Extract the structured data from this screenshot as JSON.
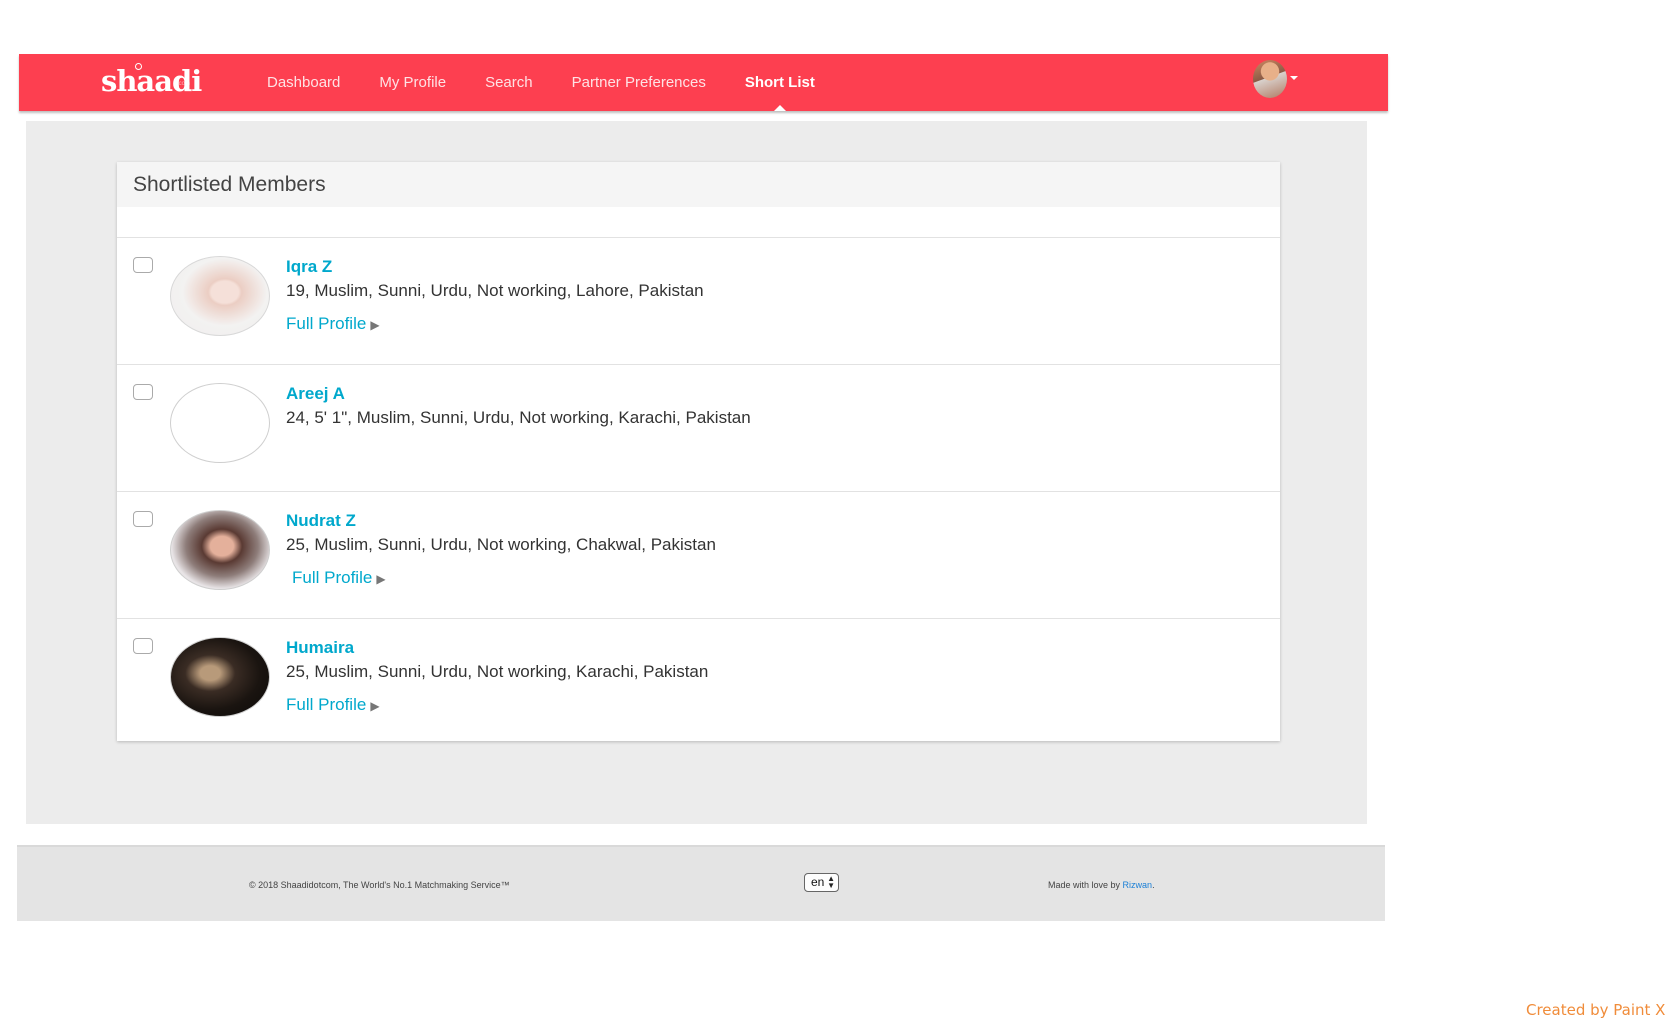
{
  "navbar": {
    "logo": "shaadi",
    "logo_sub": ".com",
    "items": [
      {
        "label": "Dashboard"
      },
      {
        "label": "My Profile"
      },
      {
        "label": "Search"
      },
      {
        "label": "Partner Preferences"
      },
      {
        "label": "Short List",
        "active": true
      }
    ]
  },
  "card": {
    "title": "Shortlisted Members",
    "members": [
      {
        "name": "Iqra Z",
        "details": "19, Muslim, Sunni, Urdu, Not working, Lahore, Pakistan",
        "link": "Full Profile"
      },
      {
        "name": "Areej A",
        "details": "24, 5' 1\", Muslim, Sunni, Urdu, Not working, Karachi, Pakistan"
      },
      {
        "name": "Nudrat Z",
        "details": "25, Muslim, Sunni, Urdu, Not working, Chakwal, Pakistan",
        "link": "Full Profile"
      },
      {
        "name": "Humaira",
        "details": "25, Muslim, Sunni, Urdu, Not working, Karachi, Pakistan",
        "link": "Full Profile"
      }
    ]
  },
  "footer": {
    "copyright": "© 2018 Shaadidotcom, The World's No.1 Matchmaking Service™",
    "language": "en",
    "made_by_prefix": "Made with love by ",
    "made_by_name": "Rizwan",
    "made_by_suffix": "."
  },
  "watermark": "Created by Paint X",
  "colors": {
    "brand": "#fd3f50",
    "link": "#00a8cc",
    "background": "#ececec"
  },
  "icons": [
    "checkbox-icon",
    "play-arrow-icon",
    "chevron-down-icon"
  ]
}
